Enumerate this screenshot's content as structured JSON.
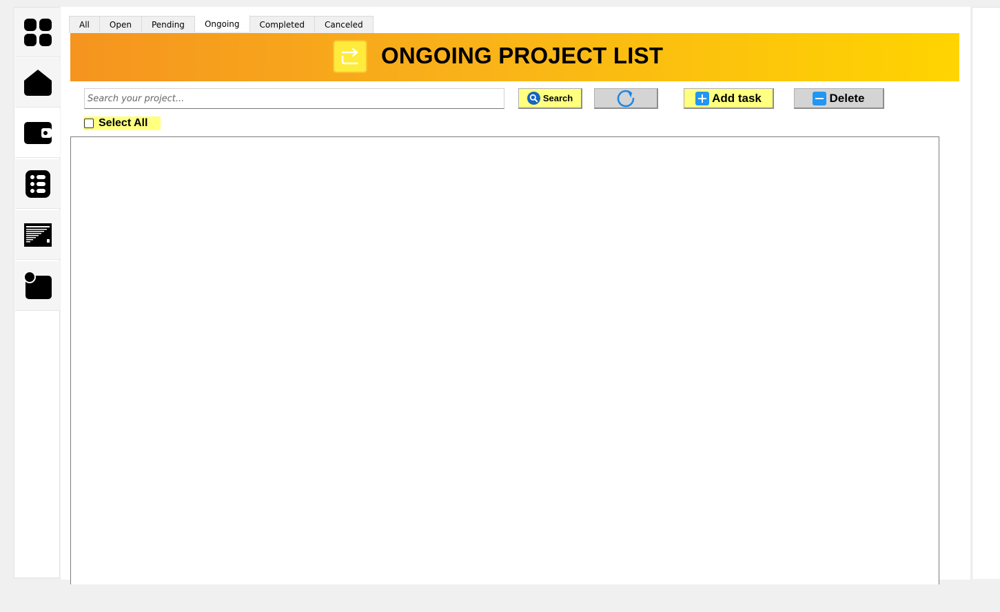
{
  "sidebar": {
    "items": [
      {
        "name": "dashboard",
        "icon": "grid-icon"
      },
      {
        "name": "home",
        "icon": "home-icon"
      },
      {
        "name": "wallet",
        "icon": "wallet-icon"
      },
      {
        "name": "task-list",
        "icon": "list-icon"
      },
      {
        "name": "report",
        "icon": "report-icon"
      },
      {
        "name": "notification",
        "icon": "notification-icon"
      }
    ],
    "active_index": 2
  },
  "tabs": [
    {
      "label": "All"
    },
    {
      "label": "Open"
    },
    {
      "label": "Pending"
    },
    {
      "label": "Ongoing",
      "active": true
    },
    {
      "label": "Completed"
    },
    {
      "label": "Canceled"
    }
  ],
  "banner": {
    "title": "ONGOING PROJECT LIST",
    "icon": "redirect-arrow-icon",
    "gradient": [
      "#f5941f",
      "#ffd400"
    ]
  },
  "toolbar": {
    "search_placeholder": "Search your project...",
    "search_value": "",
    "search_label": "Search",
    "refresh_icon": "refresh-icon",
    "add_label": "Add task",
    "delete_label": "Delete",
    "select_all_label": "Select All",
    "select_all_checked": false
  },
  "colors": {
    "button_yellow": "#ffff80",
    "button_grey": "#d4d4d4",
    "icon_blue": "#2196f3"
  },
  "projects": []
}
